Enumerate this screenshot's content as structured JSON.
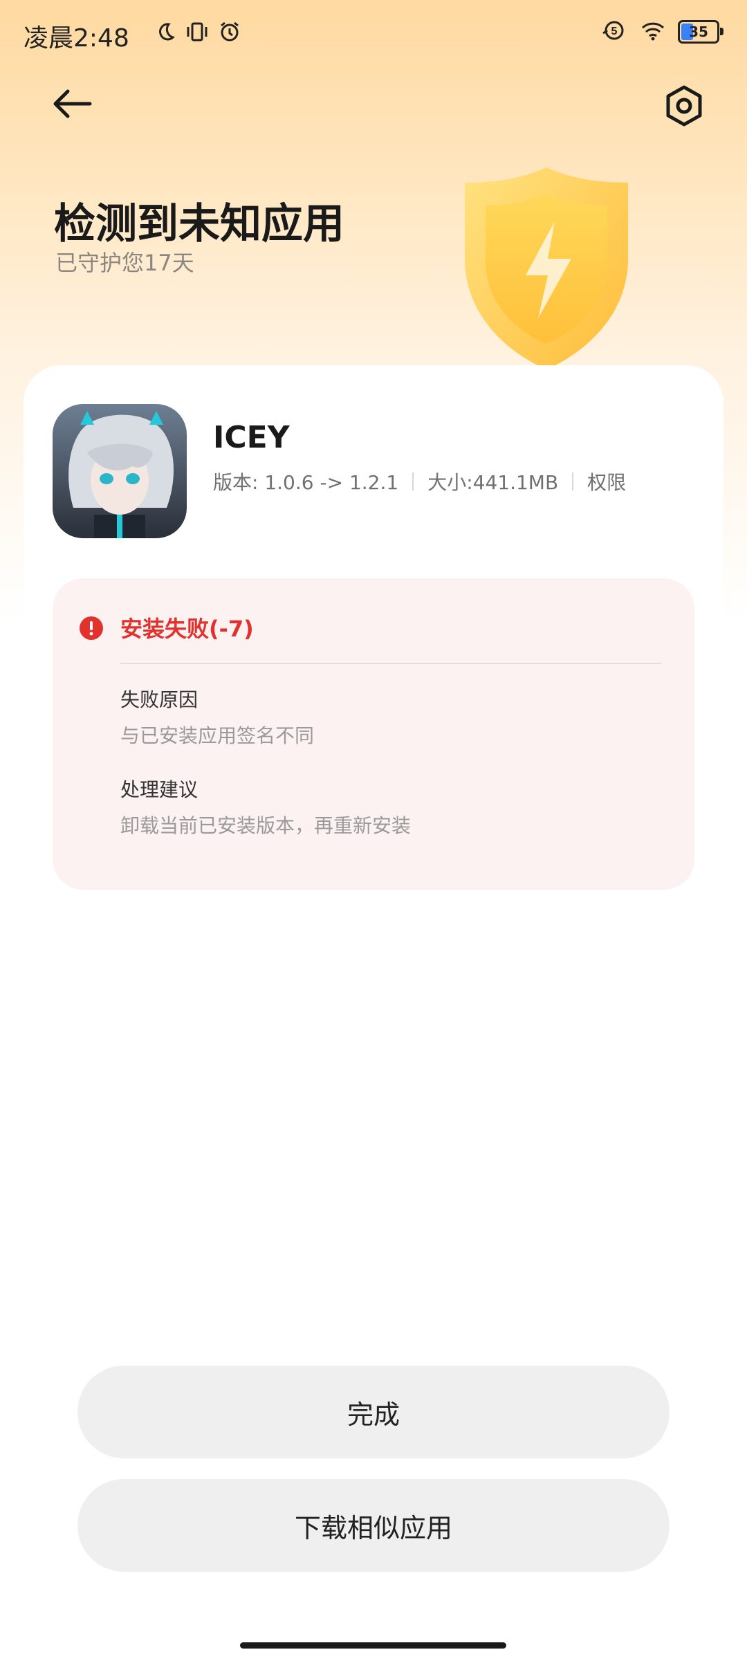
{
  "status_bar": {
    "time": "凌晨2:48",
    "battery_level": "35",
    "icons_left": [
      "moon-icon",
      "vibrate-icon",
      "alarm-icon"
    ],
    "icons_right": [
      "hd-call-icon",
      "wifi-icon",
      "battery-icon"
    ],
    "battery_color": "#3a82f7"
  },
  "header": {
    "title": "检测到未知应用",
    "subtitle": "已守护您17天"
  },
  "app": {
    "name": "ICEY",
    "version": "版本: 1.0.6 -> 1.2.1",
    "size": "大小:441.1MB",
    "permissions_label": "权限"
  },
  "error": {
    "title": "安装失败(-7)",
    "reason_label": "失败原因",
    "reason_value": "与已安装应用签名不同",
    "advice_label": "处理建议",
    "advice_value": "卸载当前已安装版本，再重新安装",
    "color": "#e2322d"
  },
  "buttons": {
    "done": "完成",
    "download_similar": "下载相似应用"
  }
}
